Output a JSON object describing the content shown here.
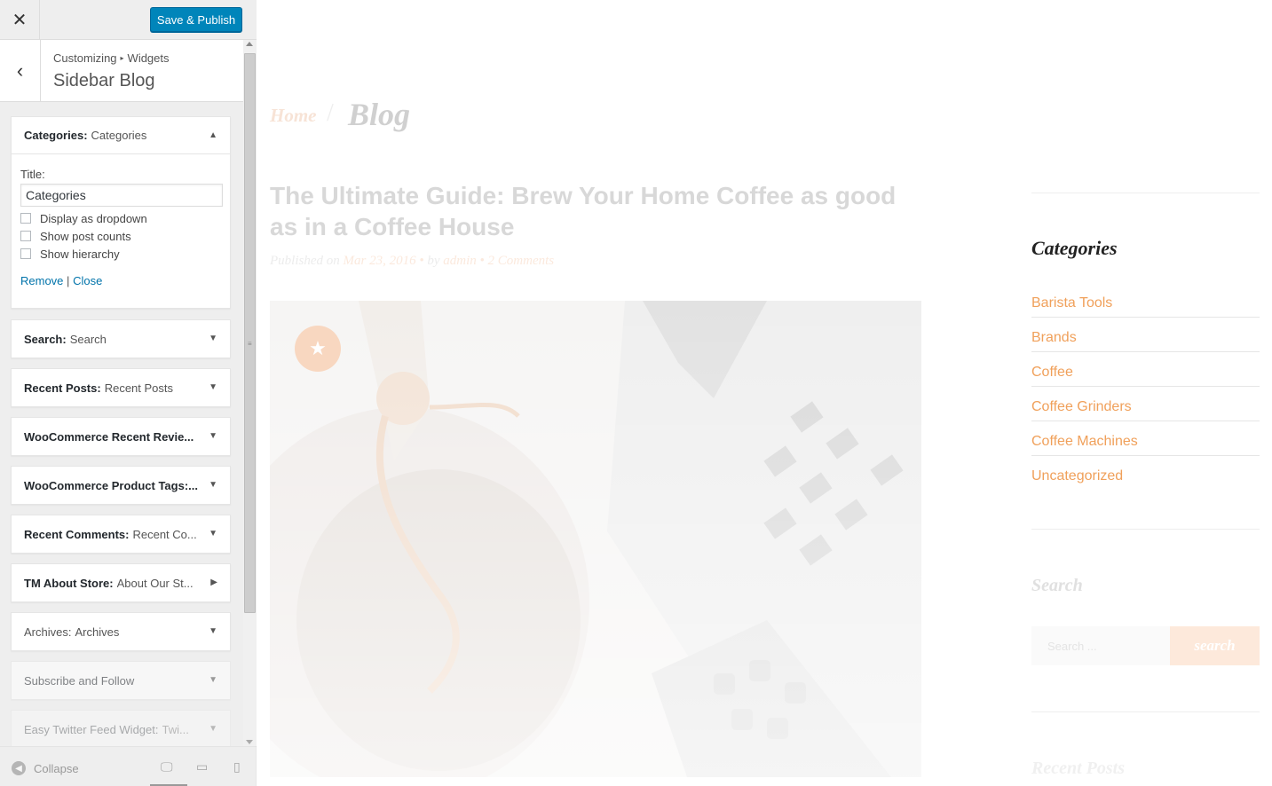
{
  "customizer": {
    "close_icon": "close-icon",
    "publish_label": "Save & Publish",
    "breadcrumb_root": "Customizing",
    "breadcrumb_section": "Widgets",
    "section_title": "Sidebar Blog",
    "back_icon": "chevron-left-icon",
    "widgets": [
      {
        "type": "Categories:",
        "title": "Categories",
        "expanded": true
      },
      {
        "type": "Search:",
        "title": "Search"
      },
      {
        "type": "Recent Posts:",
        "title": "Recent Posts"
      },
      {
        "type": "WooCommerce Recent Revie...",
        "title": ""
      },
      {
        "type": "WooCommerce Product Tags:...",
        "title": ""
      },
      {
        "type": "Recent Comments:",
        "title": "Recent Co..."
      },
      {
        "type": "TM About Store:",
        "title": "About Our St..."
      },
      {
        "type": "Archives:",
        "title": "Archives"
      },
      {
        "type": "Subscribe and Follow",
        "title": ""
      },
      {
        "type": "Easy Twitter Feed Widget:",
        "title": "Twi..."
      }
    ],
    "categories_form": {
      "title_label": "Title:",
      "title_value": "Categories",
      "options": [
        {
          "label": "Display as dropdown",
          "checked": false
        },
        {
          "label": "Show post counts",
          "checked": false
        },
        {
          "label": "Show hierarchy",
          "checked": false
        }
      ],
      "remove_label": "Remove",
      "separator": "|",
      "close_label": "Close"
    },
    "footer": {
      "collapse_label": "Collapse",
      "devices": [
        "desktop-icon",
        "tablet-icon",
        "mobile-icon"
      ]
    }
  },
  "preview": {
    "breadcrumb_home": "Home",
    "breadcrumb_separator": "/",
    "breadcrumb_current": "Blog",
    "post_title": "The Ultimate Guide: Brew Your Home Coffee as good as in a Coffee House",
    "meta_published": "Published on",
    "meta_date": "Mar 23, 2016",
    "meta_dot": "•",
    "meta_by": "by",
    "meta_author": "admin",
    "meta_comments": "2 Comments",
    "sticky_icon": "star-icon",
    "sidebar": {
      "categories_heading": "Categories",
      "categories": [
        "Barista Tools",
        "Brands",
        "Coffee",
        "Coffee Grinders",
        "Coffee Machines",
        "Uncategorized"
      ],
      "search_heading": "Search",
      "search_placeholder": "Search ...",
      "search_button": "search",
      "recent_posts_heading": "Recent Posts"
    }
  },
  "colors": {
    "accent": "#0085ba",
    "link": "#0073aa",
    "preview_accent": "#f0a05a"
  }
}
